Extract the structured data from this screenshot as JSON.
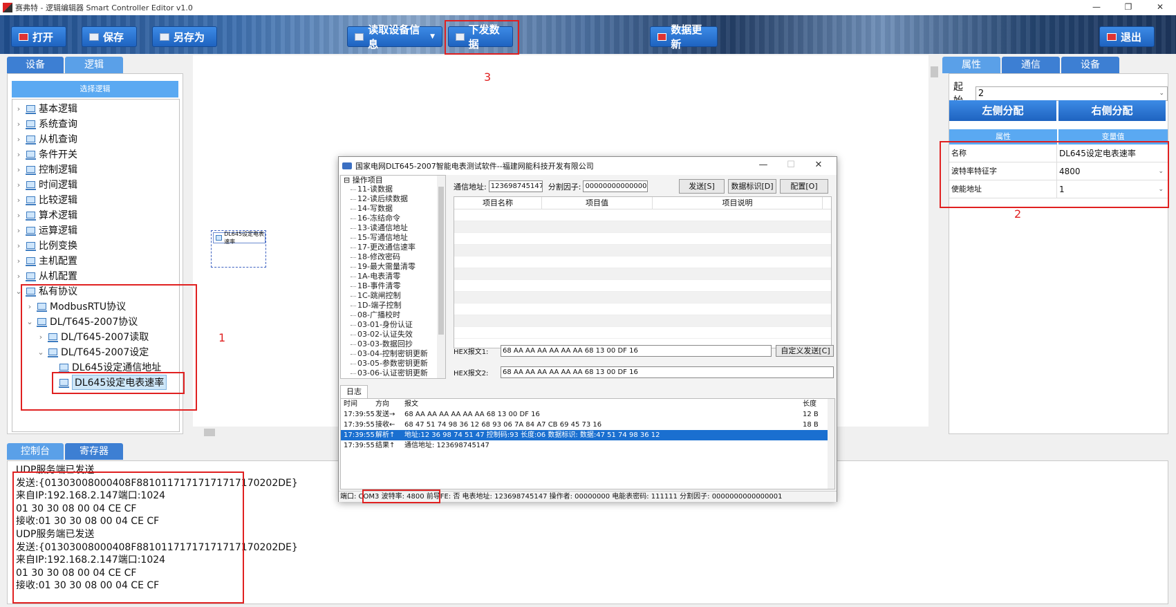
{
  "window": {
    "title": "赛弗特 - 逻辑编辑器 Smart Controller Editor v1.0",
    "controls": [
      "—",
      "❐",
      "✕"
    ]
  },
  "toolbar": {
    "open": "打开",
    "save": "保存",
    "save_as": "另存为",
    "read_device": "读取设备信息",
    "send_data": "下发数据",
    "update_data": "数据更新",
    "exit": "退出"
  },
  "left_tabs": [
    "设备",
    "逻辑"
  ],
  "tree": {
    "header": "选择逻辑",
    "items": [
      {
        "label": "基本逻辑",
        "level": 0,
        "arrow": "›"
      },
      {
        "label": "系统查询",
        "level": 0,
        "arrow": "›"
      },
      {
        "label": "从机查询",
        "level": 0,
        "arrow": "›"
      },
      {
        "label": "条件开关",
        "level": 0,
        "arrow": "›"
      },
      {
        "label": "控制逻辑",
        "level": 0,
        "arrow": "›"
      },
      {
        "label": "时间逻辑",
        "level": 0,
        "arrow": "›"
      },
      {
        "label": "比较逻辑",
        "level": 0,
        "arrow": "›"
      },
      {
        "label": "算术逻辑",
        "level": 0,
        "arrow": "›"
      },
      {
        "label": "运算逻辑",
        "level": 0,
        "arrow": "›"
      },
      {
        "label": "比例变换",
        "level": 0,
        "arrow": "›"
      },
      {
        "label": "主机配置",
        "level": 0,
        "arrow": "›"
      },
      {
        "label": "从机配置",
        "level": 0,
        "arrow": "›"
      },
      {
        "label": "私有协议",
        "level": 0,
        "arrow": "⌄"
      },
      {
        "label": "ModbusRTU协议",
        "level": 1,
        "arrow": "›"
      },
      {
        "label": "DL/T645-2007协议",
        "level": 1,
        "arrow": "⌄"
      },
      {
        "label": "DL/T645-2007读取",
        "level": 2,
        "arrow": "›"
      },
      {
        "label": "DL/T645-2007设定",
        "level": 2,
        "arrow": "⌄"
      },
      {
        "label": "DL645设定通信地址",
        "level": 3,
        "arrow": ""
      },
      {
        "label": "DL645设定电表速率",
        "level": 3,
        "arrow": "",
        "selected": true
      }
    ]
  },
  "annotations": {
    "n1": "1",
    "n2": "2",
    "n3": "3"
  },
  "canvas_node": {
    "label": "DL645设定电表速率"
  },
  "right_tabs": [
    "属性",
    "通信",
    "设备"
  ],
  "props": {
    "start_label": "起始",
    "start_value": "2",
    "left_assign": "左侧分配",
    "right_assign": "右侧分配",
    "col_prop": "属性",
    "col_value": "变量值",
    "rows": [
      {
        "key": "名称",
        "value": "DL645设定电表速率",
        "combo": false
      },
      {
        "key": "波特率特征字",
        "value": "4800",
        "combo": true
      },
      {
        "key": "使能地址",
        "value": "1",
        "combo": true
      }
    ]
  },
  "bottom_tabs": [
    "控制台",
    "寄存器"
  ],
  "console": [
    "UDP服务端已发送",
    "发送:{01303008000408F88101171717171717170202DE}",
    "来自IP:192.168.2.147端口:1024",
    "01 30 30 08 00 04 CE CF",
    "接收:01 30 30 08 00 04 CE CF",
    "UDP服务端已发送",
    "发送:{01303008000408F88101171717171717170202DE}",
    "来自IP:192.168.2.147端口:1024",
    "01 30 30 08 00 04 CE CF",
    "接收:01 30 30 08 00 04 CE CF"
  ],
  "dialog": {
    "title": "国家电网DLT645-2007智能电表测试软件--福建网能科技开发有限公司",
    "tree_root": "⊟ 操作项目",
    "ops": [
      "11-读数据",
      "12-读后续数据",
      "14-写数据",
      "16-冻结命令",
      "13-读通信地址",
      "15-写通信地址",
      "17-更改通信速率",
      "18-修改密码",
      "19-最大需量清零",
      "1A-电表清零",
      "1B-事件清零",
      "1C-跳闸控制",
      "1D-端子控制",
      "08-广播校时",
      "03-01-身份认证",
      "03-02-认证失效",
      "03-03-数据回抄",
      "03-04-控制密钥更新",
      "03-05-参数密钥更新",
      "03-06-认证密钥更新"
    ],
    "addr_label": "通信地址:",
    "addr_value": "123698745147",
    "factor_label": "分割因子:",
    "factor_value": "0000000000000001",
    "send_btn": "发送[S]",
    "data_id_btn": "数据标识[D]",
    "config_btn": "配置[O]",
    "grid_headers": [
      "项目名称",
      "项目值",
      "项目说明"
    ],
    "hex1_label": "HEX报文1:",
    "hex1_value": "68 AA AA AA AA AA AA 68 13 00 DF 16",
    "hex2_label": "HEX报文2:",
    "hex2_value": "68 AA AA AA AA AA AA 68 13 00 DF 16",
    "custom_send": "自定义发送[C]",
    "log_tab": "日志",
    "log_headers": [
      "时间",
      "方向",
      "报文",
      "长度"
    ],
    "log_rows": [
      {
        "time": "17:39:55",
        "dir": "发送→",
        "msg": "68 AA AA AA AA AA AA 68 13 00 DF 16",
        "len": "12 B",
        "sel": false
      },
      {
        "time": "17:39:55",
        "dir": "接收←",
        "msg": "68 47 51 74 98 36 12 68 93 06 7A 84 A7 CB 69 45 73 16",
        "len": "18 B",
        "sel": false
      },
      {
        "time": "17:39:55",
        "dir": "解析↑",
        "msg": "地址:12 36 98 74 51 47 控制码:93 长度:06 数据标识: 数据:47 51 74 98 36 12",
        "len": "",
        "sel": true
      },
      {
        "time": "17:39:55",
        "dir": "结果↑",
        "msg": "通信地址: 123698745147",
        "len": "",
        "sel": false
      }
    ],
    "status": "端口: COM3 波特率: 4800 前导FE: 否 电表地址: 123698745147 操作者: 00000000 电能表密码: 111111 分割因子: 0000000000000001"
  }
}
